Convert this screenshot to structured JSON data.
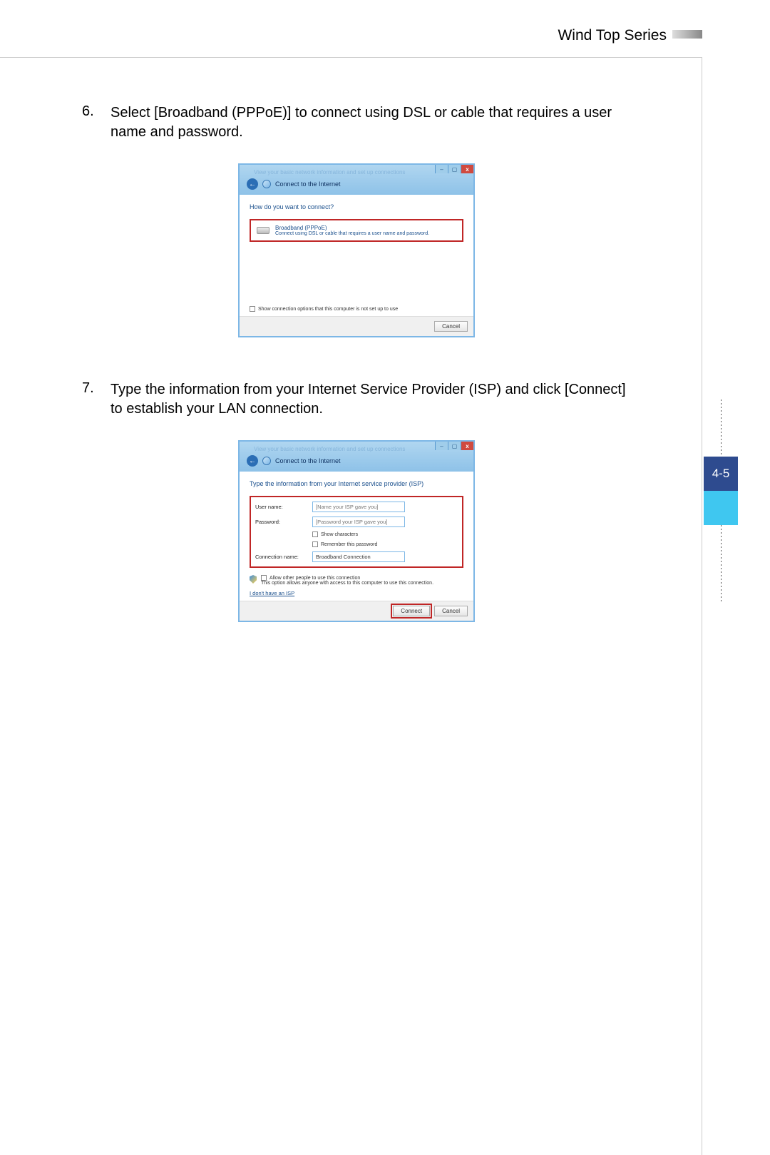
{
  "header": {
    "title": "Wind Top Series"
  },
  "page_number": "4-5",
  "steps": {
    "s6": {
      "num": "6.",
      "text": "Select [Broadband (PPPoE)] to connect using DSL or cable that requires a user name and password."
    },
    "s7": {
      "num": "7.",
      "text": "Type the information from your Internet Service Provider (ISP) and click [Connect] to establish your LAN connection."
    }
  },
  "dialog1": {
    "titlebar_faded": "View your basic network information and set up connections",
    "breadcrumb": "Connect to the Internet",
    "heading": "How do you want to connect?",
    "option_title": "Broadband (PPPoE)",
    "option_sub": "Connect using DSL or cable that requires a user name and password.",
    "show_options": "Show connection options that this computer is not set up to use",
    "cancel": "Cancel",
    "win": {
      "min": "–",
      "max": "▢",
      "close": "x"
    }
  },
  "dialog2": {
    "titlebar_faded": "View your basic network information and set up connections",
    "breadcrumb": "Connect to the Internet",
    "heading": "Type the information from your Internet service provider (ISP)",
    "labels": {
      "user": "User name:",
      "pass": "Password:",
      "conn": "Connection name:"
    },
    "placeholders": {
      "user": "[Name your ISP gave you]",
      "pass": "[Password your ISP gave you]"
    },
    "conn_value": "Broadband Connection",
    "show_chars": "Show characters",
    "remember": "Remember this password",
    "allow_label": "Allow other people to use this connection",
    "allow_sub": "This option allows anyone with access to this computer to use this connection.",
    "isp_link": "I don't have an ISP",
    "connect": "Connect",
    "cancel": "Cancel",
    "win": {
      "min": "–",
      "max": "▢",
      "close": "x"
    }
  }
}
